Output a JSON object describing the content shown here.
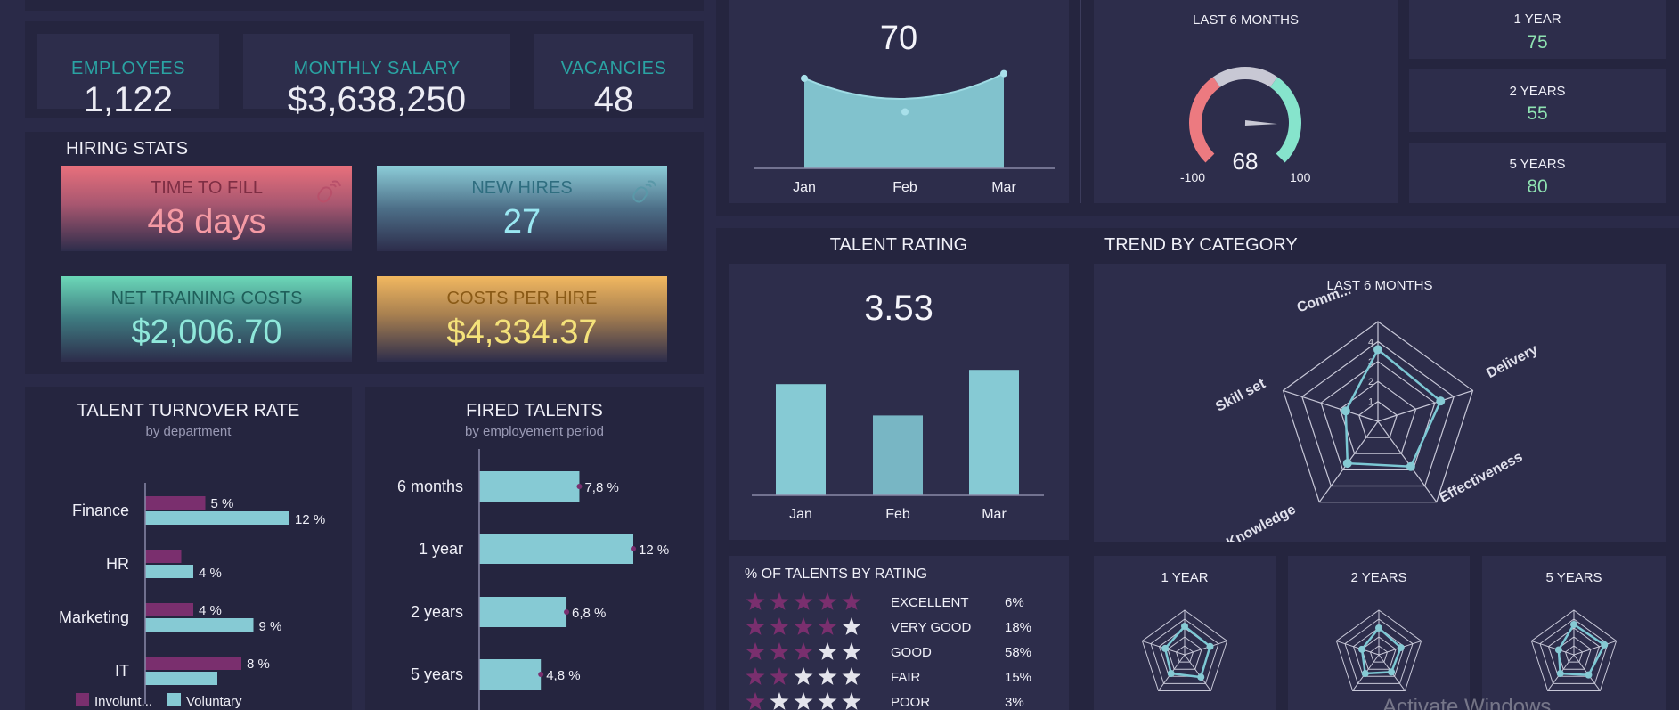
{
  "kpis": {
    "employees": {
      "label": "EMPLOYEES",
      "value": "1,122"
    },
    "salary": {
      "label": "MONTHLY SALARY",
      "value": "$3,638,250"
    },
    "vacancies": {
      "label": "VACANCIES",
      "value": "48"
    }
  },
  "hiring": {
    "title": "HIRING STATS",
    "time_to_fill": {
      "label": "TIME TO FILL",
      "value": "48 days"
    },
    "new_hires": {
      "label": "NEW HIRES",
      "value": "27"
    },
    "training": {
      "label": "NET TRAINING COSTS",
      "value": "$2,006.70"
    },
    "cost_per_hire": {
      "label": "COSTS PER HIRE",
      "value": "$4,334.37"
    }
  },
  "top_area": {
    "big_value": "70",
    "months": [
      "Jan",
      "Feb",
      "Mar"
    ]
  },
  "gauge": {
    "title": "LAST 6 MONTHS",
    "value": "68",
    "min": "-100",
    "max": "100"
  },
  "periods": [
    {
      "label": "1 YEAR",
      "value": "75"
    },
    {
      "label": "2 YEARS",
      "value": "55"
    },
    {
      "label": "5 YEARS",
      "value": "80"
    }
  ],
  "talent_rating": {
    "title": "TALENT RATING",
    "value": "3.53"
  },
  "rating_table": {
    "title": "% OF TALENTS BY RATING",
    "rows": [
      {
        "label": "EXCELLENT",
        "pct": "6%",
        "stars": 5
      },
      {
        "label": "VERY GOOD",
        "pct": "18%",
        "stars": 4
      },
      {
        "label": "GOOD",
        "pct": "58%",
        "stars": 3
      },
      {
        "label": "FAIR",
        "pct": "15%",
        "stars": 2
      },
      {
        "label": "POOR",
        "pct": "3%",
        "stars": 1
      }
    ]
  },
  "trend": {
    "title": "TREND BY CATEGORY",
    "subtitle": "LAST 6 MONTHS",
    "small_titles": [
      "1 YEAR",
      "2 YEARS",
      "5 YEARS"
    ]
  },
  "turnover": {
    "title": "TALENT TURNOVER RATE",
    "subtitle": "by department"
  },
  "fired": {
    "title": "FIRED TALENTS",
    "subtitle": "by employement period"
  },
  "watermark": "Activate Windows",
  "colors": {
    "teal": "#86cad4",
    "purple": "#7a2f6e",
    "green": "#8fe3b2",
    "red": "#e87a7a",
    "pink": "#f08a9a"
  },
  "chart_data": [
    {
      "type": "area",
      "categories": [
        "Jan",
        "Feb",
        "Mar"
      ],
      "values": [
        76,
        56,
        80
      ],
      "ylim": [
        0,
        100
      ]
    },
    {
      "type": "bar",
      "categories": [
        "Jan",
        "Feb",
        "Mar"
      ],
      "values": [
        3.9,
        2.8,
        4.4
      ],
      "ylim": [
        0,
        5
      ]
    },
    {
      "type": "bar",
      "orientation": "horizontal",
      "categories": [
        "Finance",
        "HR",
        "Marketing",
        "IT"
      ],
      "series": [
        {
          "name": "Involunt...",
          "values": [
            5,
            3,
            4,
            8
          ],
          "labels": [
            "5 %",
            "",
            "4 %",
            "8 %"
          ]
        },
        {
          "name": "Voluntary",
          "values": [
            12,
            4,
            9,
            6
          ],
          "labels": [
            "12 %",
            "4 %",
            "9 %",
            ""
          ]
        }
      ],
      "xlim": [
        0,
        13
      ]
    },
    {
      "type": "bar",
      "orientation": "horizontal",
      "categories": [
        "6 months",
        "1 year",
        "2 years",
        "5 years"
      ],
      "values": [
        7.8,
        12,
        6.8,
        4.8
      ],
      "labels": [
        "7,8 %",
        "12 %",
        "6,8 %",
        "4,8 %"
      ],
      "xlim": [
        0,
        12
      ]
    },
    {
      "type": "radar",
      "categories": [
        "Comm...",
        "Delivery",
        "Effectiveness",
        "Knowledge",
        "Skill set"
      ],
      "values": [
        3.6,
        3.3,
        2.8,
        2.6,
        1.7
      ],
      "ticks": [
        "1",
        "2",
        "3",
        "4"
      ],
      "rmax": 5
    },
    {
      "type": "radar",
      "title": "1 YEAR",
      "categories": [
        "Comm...",
        "Delivery",
        "Effectiveness",
        "Knowledge",
        "Skill set"
      ],
      "values": [
        3.2,
        3.0,
        3.1,
        2.6,
        2.3
      ],
      "rmax": 5
    },
    {
      "type": "radar",
      "title": "2 YEARS",
      "categories": [
        "Comm...",
        "Delivery",
        "Effectiveness",
        "Knowledge",
        "Skill set"
      ],
      "values": [
        3.0,
        2.6,
        2.4,
        2.6,
        2.0
      ],
      "rmax": 5
    },
    {
      "type": "radar",
      "title": "5 YEARS",
      "categories": [
        "Comm...",
        "Delivery",
        "Effectiveness",
        "Knowledge",
        "Skill set"
      ],
      "values": [
        3.4,
        3.6,
        2.8,
        2.6,
        1.8
      ],
      "rmax": 5
    },
    {
      "type": "gauge",
      "value": 68,
      "range": [
        -100,
        100
      ]
    }
  ]
}
